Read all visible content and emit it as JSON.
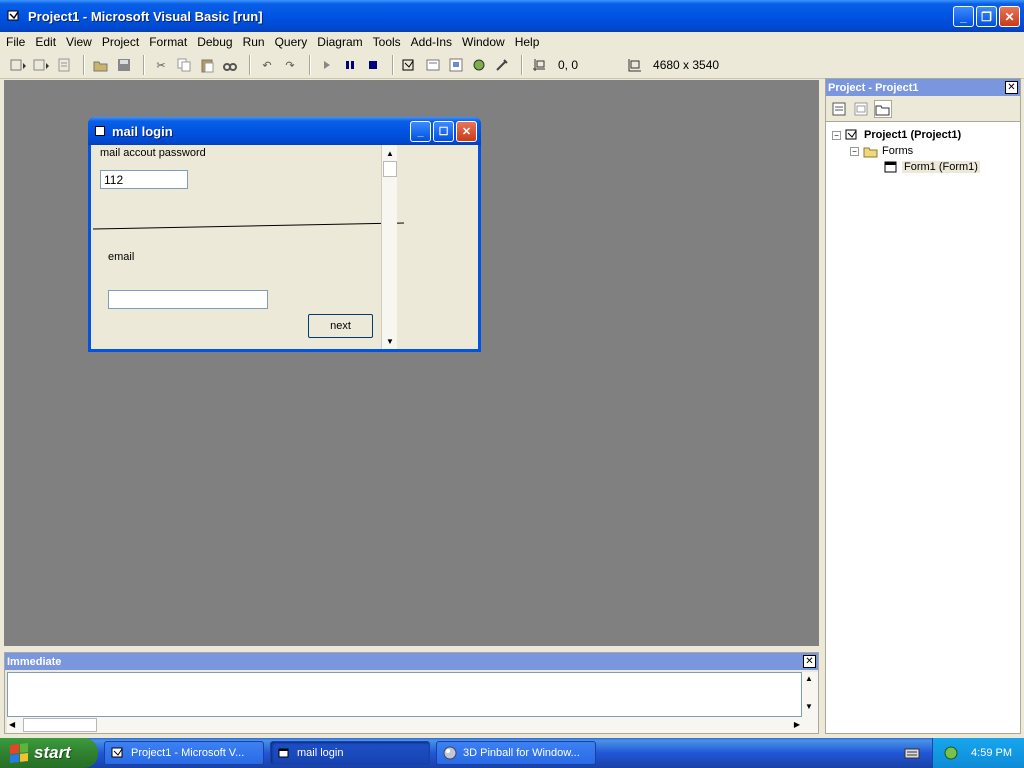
{
  "window": {
    "title": "Project1 - Microsoft Visual Basic [run]"
  },
  "menu": [
    "File",
    "Edit",
    "View",
    "Project",
    "Format",
    "Debug",
    "Run",
    "Query",
    "Diagram",
    "Tools",
    "Add-Ins",
    "Window",
    "Help"
  ],
  "toolbar": {
    "position_readout": "0, 0",
    "size_readout": "4680 x 3540"
  },
  "form": {
    "title": "mail login",
    "password_label": "mail accout password",
    "password_value": "112",
    "email_label": "email",
    "email_value": "",
    "next_label": "next"
  },
  "project_panel": {
    "title": "Project - Project1",
    "tree": {
      "root": "Project1 (Project1)",
      "folder": "Forms",
      "item": "Form1 (Form1)"
    }
  },
  "immediate": {
    "title": "Immediate"
  },
  "taskbar": {
    "start_label": "start",
    "tasks": [
      "Project1 - Microsoft V...",
      "mail login",
      "3D Pinball for Window..."
    ],
    "clock": "4:59 PM"
  },
  "colors": {
    "titlebar": "#0054e3",
    "mdi_background": "#808080",
    "panel_title": "#7a96df"
  }
}
